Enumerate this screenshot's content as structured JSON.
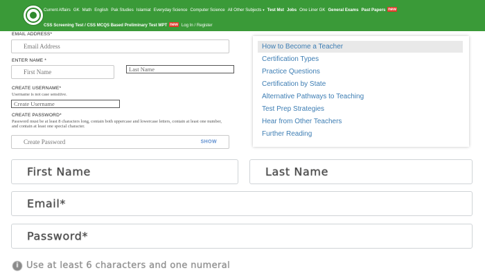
{
  "nav": {
    "row1": [
      "Current Affairs",
      "GK",
      "Math",
      "English",
      "Pak Studies",
      "Islamiat",
      "Everyday Science",
      "Computer Science",
      "All Other Subjects"
    ],
    "row1_caret": "▾",
    "row1_right": [
      "Test Mst",
      "Jobs",
      "One Liner GK",
      "General Exams",
      "Past Papers"
    ],
    "row1_badge": "new",
    "row2": [
      "CSS Screening Test / CSS MCQS Based Preliminary Test MPT",
      "Log In / Register"
    ],
    "row2_badge": "new"
  },
  "form": {
    "email_label": "EMAIL ADDRESS*",
    "email_placeholder": "Email Address",
    "name_label": "ENTER NAME *",
    "first_name_placeholder": "First Name",
    "last_name_placeholder": "Last Name",
    "username_label": "CREATE USERNAME*",
    "username_hint": "Username is not case sensitive.",
    "username_placeholder": "Create Username",
    "password_label": "CREATE PASSWORD*",
    "password_hint": "Password must be at least 8 characters long, contain both uppercase and lowercase letters, contain at least one number, and contain at least one special character.",
    "password_placeholder": "Create Password",
    "show_label": "SHOW"
  },
  "links": [
    "How to Become a Teacher",
    "Certification Types",
    "Practice Questions",
    "Certification by State",
    "Alternative Pathways to Teaching",
    "Test Prep Strategies",
    "Hear from Other Teachers",
    "Further Reading"
  ],
  "big_form": {
    "first_name": "First Name",
    "last_name": "Last Name",
    "email": "Email*",
    "password": "Password*",
    "tip_icon": "i",
    "tip": "Use at least 6 characters and one numeral"
  },
  "colors": {
    "nav_bg": "#3a9a38",
    "link": "#3d7db3",
    "show": "#5b8ccf"
  },
  "icons": {
    "logo": "site-logo",
    "tip": "info-icon"
  }
}
